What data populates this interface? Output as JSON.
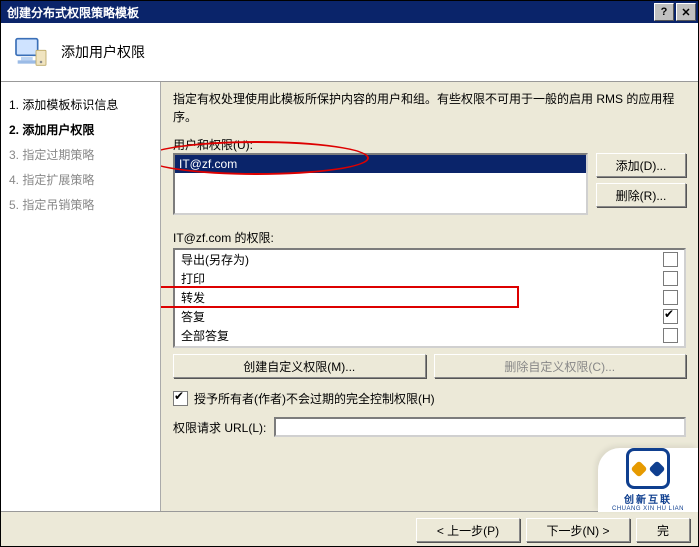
{
  "title": "创建分布式权限策略模板",
  "header": {
    "title": "添加用户权限"
  },
  "steps": [
    {
      "n": "1.",
      "label": "添加模板标识信息",
      "state": "done"
    },
    {
      "n": "2.",
      "label": "添加用户权限",
      "state": "current"
    },
    {
      "n": "3.",
      "label": "指定过期策略",
      "state": "pending"
    },
    {
      "n": "4.",
      "label": "指定扩展策略",
      "state": "pending"
    },
    {
      "n": "5.",
      "label": "指定吊销策略",
      "state": "pending"
    }
  ],
  "description": "指定有权处理使用此模板所保护内容的用户和组。有些权限不可用于一般的启用 RMS 的应用程序。",
  "users_label": "用户和权限(U):",
  "user_selected": "IT@zf.com",
  "buttons": {
    "add": "添加(D)...",
    "remove": "删除(R)..."
  },
  "permissions_label_prefix": "IT@zf.com 的权限:",
  "permissions": [
    {
      "name": "导出(另存为)",
      "checked": false
    },
    {
      "name": "打印",
      "checked": false
    },
    {
      "name": "转发",
      "checked": false
    },
    {
      "name": "答复",
      "checked": true
    },
    {
      "name": "全部答复",
      "checked": false
    }
  ],
  "custom_buttons": {
    "create": "创建自定义权限(M)...",
    "delete": "删除自定义权限(C)..."
  },
  "author_checkbox": {
    "label": "授予所有者(作者)不会过期的完全控制权限(H)",
    "checked": true
  },
  "url_label": "权限请求 URL(L):",
  "url_value": "",
  "footer": {
    "back": "< 上一步(P)",
    "next": "下一步(N) >",
    "finish": "完"
  },
  "watermark": {
    "line1": "创新互联",
    "line2": "CHUANG XIN HU LIAN"
  },
  "annotation_color": "#d00000"
}
